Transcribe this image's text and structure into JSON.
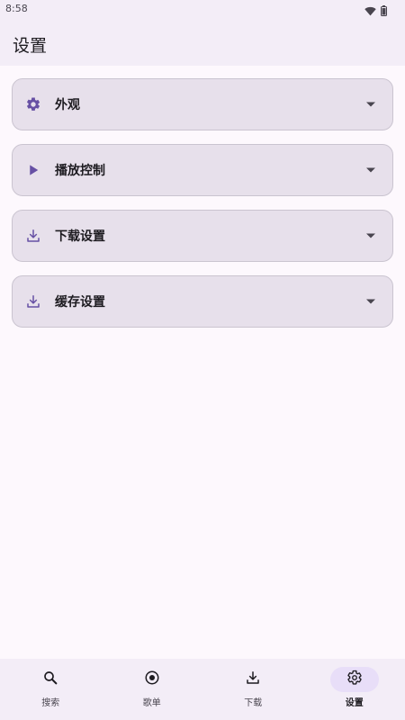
{
  "status_bar": {
    "time": "8:58",
    "wifi_icon": "wifi-icon",
    "battery_icon": "battery-icon"
  },
  "app_bar": {
    "title": "设置"
  },
  "settings": {
    "items": [
      {
        "label": "外观",
        "icon": "gear-icon"
      },
      {
        "label": "播放控制",
        "icon": "play-icon"
      },
      {
        "label": "下载设置",
        "icon": "download-icon"
      },
      {
        "label": "缓存设置",
        "icon": "download-icon"
      }
    ],
    "expand_icon": "caret-down-icon"
  },
  "bottom_nav": {
    "items": [
      {
        "label": "搜索",
        "icon": "search-icon",
        "active": false
      },
      {
        "label": "歌单",
        "icon": "disc-icon",
        "active": false
      },
      {
        "label": "下载",
        "icon": "download-icon",
        "active": false
      },
      {
        "label": "设置",
        "icon": "gear-icon",
        "active": true
      }
    ]
  },
  "colors": {
    "background": "#fdf8fd",
    "surface": "#f3edf7",
    "card": "#e7e0eb",
    "card_border": "#cac4d0",
    "accent": "#6750a4",
    "active_indicator": "#e8def8",
    "text_primary": "#1d1b20",
    "text_secondary": "#49454f"
  }
}
